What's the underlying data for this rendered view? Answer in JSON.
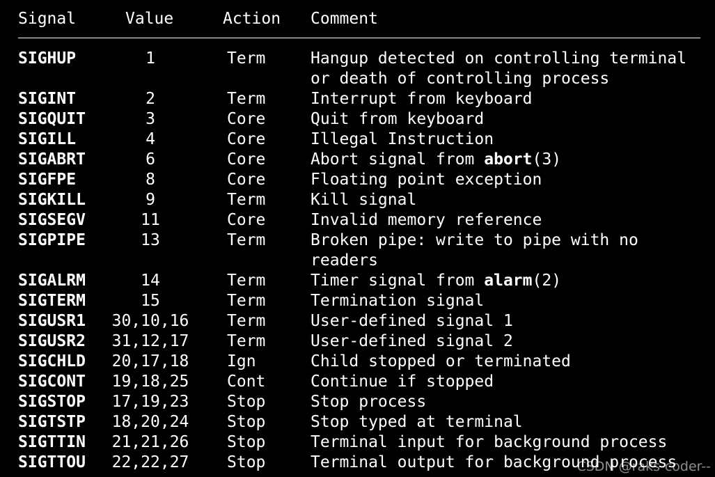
{
  "header": {
    "signal": "Signal",
    "value": "Value",
    "action": "Action",
    "comment": "Comment"
  },
  "rows": [
    {
      "signal": "SIGHUP",
      "value": "1",
      "action": "Term",
      "comment": [
        "Hangup detected on controlling terminal",
        "or death of controlling process"
      ]
    },
    {
      "signal": "SIGINT",
      "value": "2",
      "action": "Term",
      "comment": [
        "Interrupt from keyboard"
      ]
    },
    {
      "signal": "SIGQUIT",
      "value": "3",
      "action": "Core",
      "comment": [
        "Quit from keyboard"
      ]
    },
    {
      "signal": "SIGILL",
      "value": "4",
      "action": "Core",
      "comment": [
        "Illegal Instruction"
      ]
    },
    {
      "signal": "SIGABRT",
      "value": "6",
      "action": "Core",
      "comment_parts": {
        "pre": "Abort signal from ",
        "bold": "abort",
        "post": "(3)"
      }
    },
    {
      "signal": "SIGFPE",
      "value": "8",
      "action": "Core",
      "comment": [
        "Floating point exception"
      ]
    },
    {
      "signal": "SIGKILL",
      "value": "9",
      "action": "Term",
      "comment": [
        "Kill signal"
      ]
    },
    {
      "signal": "SIGSEGV",
      "value": "11",
      "action": "Core",
      "comment": [
        "Invalid memory reference"
      ]
    },
    {
      "signal": "SIGPIPE",
      "value": "13",
      "action": "Term",
      "comment": [
        "Broken pipe: write to pipe with no",
        "readers"
      ]
    },
    {
      "signal": "SIGALRM",
      "value": "14",
      "action": "Term",
      "comment_parts": {
        "pre": "Timer signal from ",
        "bold": "alarm",
        "post": "(2)"
      }
    },
    {
      "signal": "SIGTERM",
      "value": "15",
      "action": "Term",
      "comment": [
        "Termination signal"
      ]
    },
    {
      "signal": "SIGUSR1",
      "value": "30,10,16",
      "action": "Term",
      "comment": [
        "User-defined signal 1"
      ]
    },
    {
      "signal": "SIGUSR2",
      "value": "31,12,17",
      "action": "Term",
      "comment": [
        "User-defined signal 2"
      ]
    },
    {
      "signal": "SIGCHLD",
      "value": "20,17,18",
      "action": "Ign",
      "comment": [
        "Child stopped or terminated"
      ]
    },
    {
      "signal": "SIGCONT",
      "value": "19,18,25",
      "action": "Cont",
      "comment": [
        "Continue if stopped"
      ]
    },
    {
      "signal": "SIGSTOP",
      "value": "17,19,23",
      "action": "Stop",
      "comment": [
        "Stop process"
      ]
    },
    {
      "signal": "SIGTSTP",
      "value": "18,20,24",
      "action": "Stop",
      "comment": [
        "Stop typed at terminal"
      ]
    },
    {
      "signal": "SIGTTIN",
      "value": "21,21,26",
      "action": "Stop",
      "comment": [
        "Terminal input for background process"
      ]
    },
    {
      "signal": "SIGTTOU",
      "value": "22,22,27",
      "action": "Stop",
      "comment": [
        "Terminal output for background process"
      ]
    }
  ],
  "watermark": "CSDN @raks-coder--"
}
